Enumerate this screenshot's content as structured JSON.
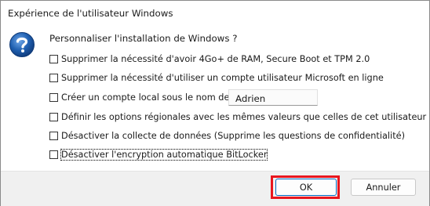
{
  "window": {
    "title": "Expérience de l'utilisateur Windows"
  },
  "dialog": {
    "question": "Personnaliser l'installation de Windows ?",
    "options": [
      {
        "label": "Supprimer la nécessité d'avoir 4Go+ de RAM, Secure Boot et TPM 2.0",
        "checked": false
      },
      {
        "label": "Supprimer la nécessité d'utiliser un compte utilisateur Microsoft en ligne",
        "checked": false
      },
      {
        "label": "Créer un compte local sous le nom de :",
        "checked": false
      },
      {
        "label": "Définir les options régionales avec les mêmes valeurs que celles de cet utilisateur",
        "checked": false
      },
      {
        "label": "Désactiver la collecte de données (Supprime les questions de confidentialité)",
        "checked": false
      },
      {
        "label": "Désactiver l'encryption automatique BitLocker",
        "checked": false
      }
    ],
    "local_account_name": "Adrien"
  },
  "buttons": {
    "ok_label": "OK",
    "cancel_label": "Annuler"
  },
  "colors": {
    "highlight": "#e8161f",
    "help_icon": "#1f5fb0"
  },
  "icons": {
    "help": "question-mark-icon"
  }
}
